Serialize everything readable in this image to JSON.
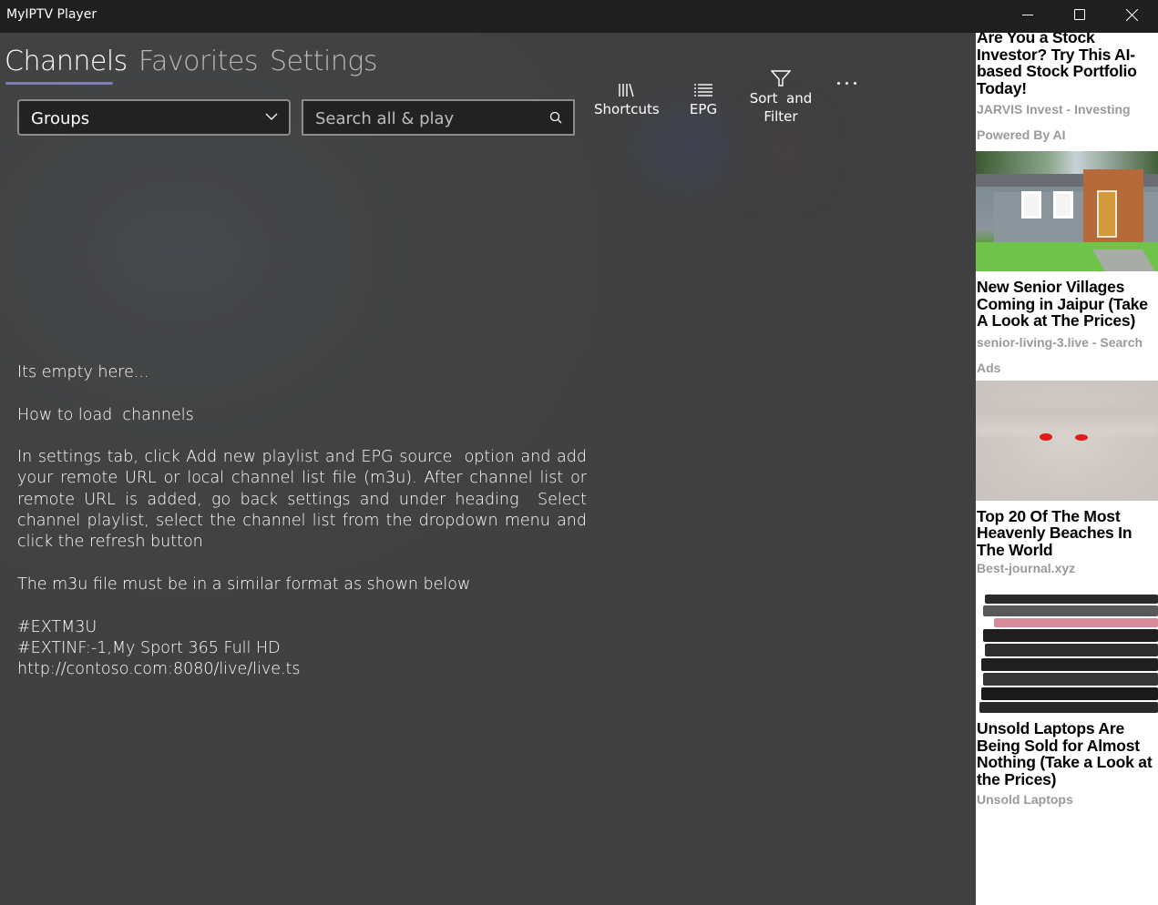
{
  "window": {
    "title": "MyIPTV Player",
    "controls": {
      "minimize": "minimize-icon",
      "maximize": "maximize-icon",
      "close": "close-icon"
    }
  },
  "tabs": [
    {
      "label": "Channels",
      "active": true
    },
    {
      "label": "Favorites",
      "active": false
    },
    {
      "label": "Settings",
      "active": false
    }
  ],
  "accent_color": "#7c7fb8",
  "groups_dropdown": {
    "value": "Groups",
    "icon": "chevron-down-icon"
  },
  "search": {
    "placeholder": "Search all & play",
    "value": "",
    "icon": "search-icon"
  },
  "commands": [
    {
      "label": "Shortcuts",
      "icon": "library-icon"
    },
    {
      "label": "EPG",
      "icon": "list-icon"
    },
    {
      "label": "Sort  and Filter",
      "line1": "Sort  and",
      "line2": "Filter",
      "icon": "filter-icon"
    },
    {
      "label": "More",
      "icon": "more-icon"
    }
  ],
  "empty_state": {
    "heading": "Its empty here...",
    "subheading": "How to load  channels",
    "instructions": "In settings tab, click Add new playlist and EPG source  option and add your remote URL or local channel list file (m3u). After channel list or remote URL is added, go back settings and under heading  Select channel playlist, select the channel list from the dropdown menu and click the refresh button",
    "format_note": "The m3u file must be in a similar format as shown below",
    "example_lines": [
      "#EXTM3U",
      "#EXTINF:-1,My Sport 365 Full HD",
      "http://contoso.com:8080/live/live.ts"
    ]
  },
  "ads": [
    {
      "title": "Are You a Stock Investor? Try This AI-based Stock Portfolio Today!",
      "source": "JARVIS Invest - Investing",
      "extra": "Powered By AI",
      "image": null
    },
    {
      "title": "New Senior Villages Coming in Jaipur (Take A Look at The Prices)",
      "source": "senior-living-3.live - Search Ads",
      "image": "house-photo"
    },
    {
      "title": "Top 20 Of The Most Heavenly Beaches In The World",
      "source": "Best-journal.xyz",
      "image": "beach-sand-photo"
    },
    {
      "title": "Unsold Laptops Are Being Sold for Almost Nothing (Take a Look at the Prices)",
      "source": "Unsold Laptops",
      "image": "laptop-stack-photo"
    }
  ]
}
